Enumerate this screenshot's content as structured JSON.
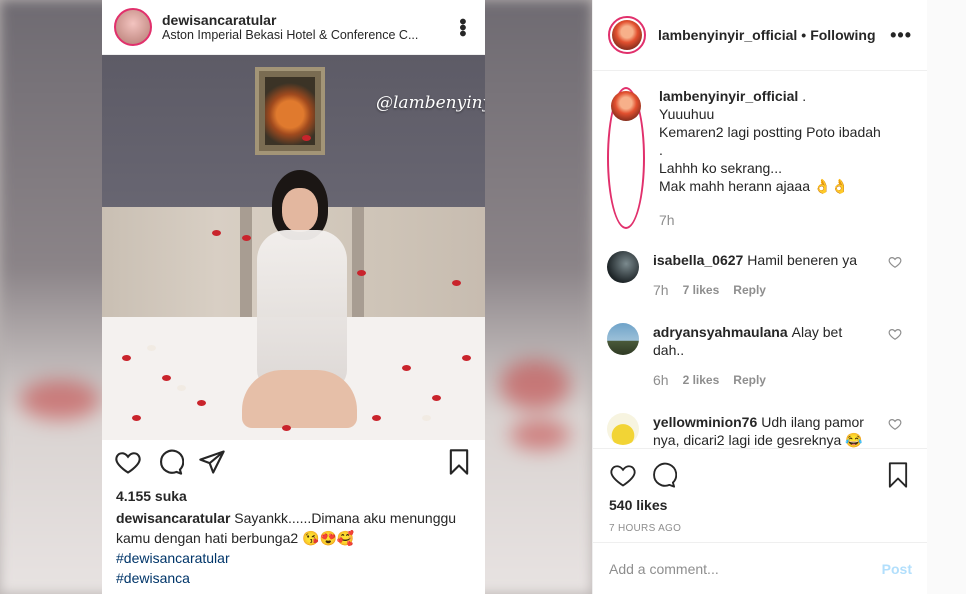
{
  "inner_post": {
    "username": "dewisancaratular",
    "location": "Aston Imperial Bekasi Hotel & Conference C...",
    "watermark": "@lambenyinyir_official",
    "likes": "4.155 suka",
    "caption_user": "dewisancaratular",
    "caption_text": "Sayankk......Dimana aku menunggu kamu dengan hati berbunga2 😘😍🥰",
    "hashtags": [
      "#dewisancaratular",
      "#dewisanca"
    ]
  },
  "side": {
    "header": {
      "username": "lambenyinyir_official",
      "dot": "•",
      "follow_status": "Following"
    },
    "caption": {
      "username": "lambenyinyir_official",
      "suffix": ".",
      "lines": [
        "Yuuuhuu",
        "Kemaren2 lagi postting Poto ibadah",
        ".",
        "Lahhh ko sekrang...",
        "Mak mahh herann ajaaa 👌👌"
      ],
      "time": "7h"
    },
    "comments": [
      {
        "username": "isabella_0627",
        "text": "Hamil beneren ya",
        "time": "7h",
        "likes": "7 likes",
        "reply": "Reply"
      },
      {
        "username": "adryansyahmaulana",
        "text": "Alay bet dah..",
        "time": "6h",
        "likes": "2 likes",
        "reply": "Reply"
      },
      {
        "username": "yellowminion76",
        "text": "Udh ilang pamor nya, dicari2 lagi ide gesreknya 😂",
        "time": "",
        "likes": "",
        "reply": ""
      }
    ],
    "likes": "540 likes",
    "timestamp": "7 HOURS AGO",
    "add_comment_placeholder": "Add a comment...",
    "post_label": "Post"
  },
  "colors": {
    "accent_ring": "#e1306c",
    "link": "#003569",
    "post_disabled": "#b2dffc",
    "muted": "#8e8e8e"
  }
}
